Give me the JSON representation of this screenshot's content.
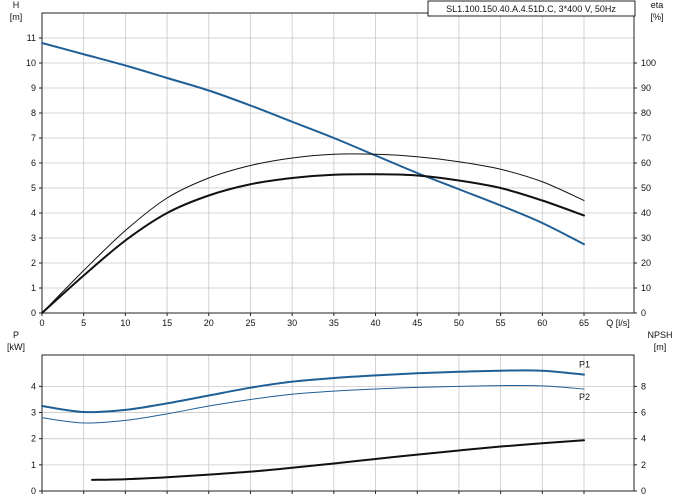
{
  "model_label": "SL1.100.150.40.A.4.51D.C, 3*400 V, 50Hz",
  "colors": {
    "blue": "#1f5f96",
    "black": "#111111",
    "grid": "#c8c8c8"
  },
  "chart_data": [
    {
      "type": "line",
      "xlabel": "Q [l/s]",
      "x_ticks": [
        0,
        5,
        10,
        15,
        20,
        25,
        30,
        35,
        40,
        45,
        50,
        55,
        60,
        65
      ],
      "xlim": [
        0,
        70
      ],
      "y_left_label_top": "H",
      "y_left_label_unit": "[m]",
      "y_left_lim": [
        0,
        12
      ],
      "y_left_ticks": [
        0,
        1,
        2,
        3,
        4,
        5,
        6,
        7,
        8,
        9,
        10,
        11
      ],
      "y_right_label_top": "eta",
      "y_right_label_unit": "[%]",
      "y_right_lim": [
        0,
        120
      ],
      "y_right_ticks": [
        0,
        10,
        20,
        30,
        40,
        50,
        60,
        70,
        80,
        90,
        100
      ],
      "grid": true,
      "series": [
        {
          "axis": "left",
          "color": "#1f5f96",
          "width": 2,
          "x": [
            0,
            5,
            10,
            15,
            20,
            25,
            30,
            35,
            40,
            45,
            50,
            55,
            60,
            65
          ],
          "y": [
            10.8,
            10.35,
            9.9,
            9.4,
            8.9,
            8.3,
            7.65,
            7.0,
            6.3,
            5.6,
            4.95,
            4.3,
            3.6,
            2.75
          ]
        },
        {
          "axis": "right",
          "color": "#111111",
          "width": 1,
          "x": [
            0,
            5,
            10,
            15,
            20,
            25,
            30,
            35,
            40,
            45,
            50,
            55,
            60,
            65
          ],
          "y": [
            0,
            17,
            33,
            46,
            54,
            59,
            62,
            63.5,
            63.5,
            62.5,
            60.5,
            57.5,
            52.5,
            45
          ]
        },
        {
          "axis": "right",
          "color": "#111111",
          "width": 2,
          "x": [
            0,
            5,
            10,
            15,
            20,
            25,
            30,
            35,
            40,
            45,
            50,
            55,
            60,
            65
          ],
          "y": [
            0,
            15,
            29,
            40,
            47,
            51.5,
            54,
            55.3,
            55.5,
            55,
            53,
            50,
            45,
            39
          ]
        }
      ]
    },
    {
      "type": "line",
      "xlim": [
        0,
        70
      ],
      "x_ticks": [
        0,
        5,
        10,
        15,
        20,
        25,
        30,
        35,
        40,
        45,
        50,
        55,
        60,
        65
      ],
      "y_left_label_top": "P",
      "y_left_label_unit": "[kW]",
      "y_left_lim": [
        0,
        5.2
      ],
      "y_left_ticks": [
        0,
        1,
        2,
        3,
        4
      ],
      "y_right_label_top": "NPSH",
      "y_right_label_unit": "[m]",
      "y_right_lim": [
        0,
        10.4
      ],
      "y_right_ticks": [
        0,
        2,
        4,
        6,
        8
      ],
      "grid": true,
      "series": [
        {
          "name": "P1",
          "axis": "left",
          "color": "#1f5f96",
          "width": 2,
          "x": [
            0,
            5,
            10,
            15,
            20,
            25,
            30,
            35,
            40,
            45,
            50,
            55,
            60,
            65
          ],
          "y": [
            3.25,
            3.02,
            3.1,
            3.35,
            3.65,
            3.95,
            4.18,
            4.32,
            4.42,
            4.5,
            4.56,
            4.6,
            4.6,
            4.45
          ]
        },
        {
          "name": "P2",
          "axis": "left",
          "color": "#1f5f96",
          "width": 1,
          "x": [
            0,
            5,
            10,
            15,
            20,
            25,
            30,
            35,
            40,
            45,
            50,
            55,
            60,
            65
          ],
          "y": [
            2.8,
            2.6,
            2.7,
            2.95,
            3.25,
            3.5,
            3.7,
            3.82,
            3.9,
            3.96,
            4.0,
            4.03,
            4.02,
            3.9
          ]
        },
        {
          "axis": "right",
          "color": "#111111",
          "width": 2,
          "x": [
            6,
            10,
            15,
            20,
            25,
            30,
            35,
            40,
            45,
            50,
            55,
            60,
            65
          ],
          "y": [
            0.85,
            0.9,
            1.05,
            1.25,
            1.48,
            1.78,
            2.1,
            2.45,
            2.78,
            3.1,
            3.4,
            3.65,
            3.88
          ]
        }
      ]
    }
  ]
}
